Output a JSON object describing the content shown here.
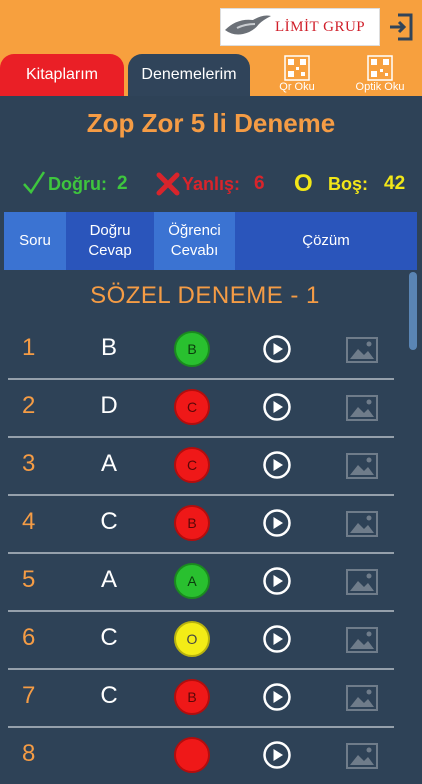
{
  "header": {
    "logo_text": "LİMİT GRUP",
    "tabs": {
      "books": "Kitaplarım",
      "exams": "Denemelerim"
    },
    "tools": {
      "qr": "Qr Oku",
      "optik": "Optik Oku"
    }
  },
  "exam": {
    "title": "Zop Zor 5 li Deneme",
    "stats": {
      "correct_label": "Doğru:",
      "correct_value": "2",
      "wrong_label": "Yanlış:",
      "wrong_value": "6",
      "empty_mark": "O",
      "empty_label": "Boş:",
      "empty_value": "42"
    }
  },
  "table_header": {
    "question": "Soru",
    "correct_answer": "Doğru\nCevap",
    "student_answer": "Öğrenci\nCevabı",
    "solution": "Çözüm"
  },
  "section_title": "SÖZEL DENEME - 1",
  "rows": [
    {
      "num": "1",
      "correct": "B",
      "student": "B",
      "status": "correct"
    },
    {
      "num": "2",
      "correct": "D",
      "student": "C",
      "status": "wrong"
    },
    {
      "num": "3",
      "correct": "A",
      "student": "C",
      "status": "wrong"
    },
    {
      "num": "4",
      "correct": "C",
      "student": "B",
      "status": "wrong"
    },
    {
      "num": "5",
      "correct": "A",
      "student": "A",
      "status": "correct"
    },
    {
      "num": "6",
      "correct": "C",
      "student": "O",
      "status": "empty"
    },
    {
      "num": "7",
      "correct": "C",
      "student": "B",
      "status": "wrong"
    },
    {
      "num": "8",
      "correct": "",
      "student": "",
      "status": "wrong"
    }
  ],
  "colors": {
    "orange": "#f7a03e",
    "red_tab": "#ea1f26",
    "navy": "#30445a",
    "correct": "#3ec63e",
    "wrong": "#d8242b",
    "empty": "#f2e718",
    "table_header": "#2a55bb"
  },
  "icons": {
    "logo": "bird-logo-icon",
    "exit": "exit-icon",
    "qr": "qr-code-icon",
    "optik": "optical-form-icon",
    "correct": "checkmark-icon",
    "wrong": "cross-icon",
    "play": "play-icon",
    "image": "image-icon"
  }
}
